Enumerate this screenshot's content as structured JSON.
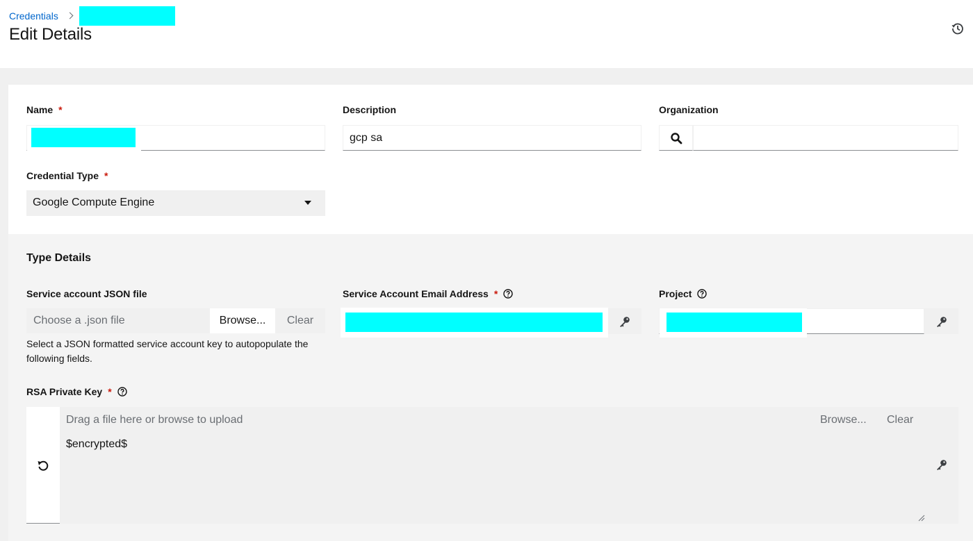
{
  "breadcrumb": {
    "root": "Credentials"
  },
  "page": {
    "title": "Edit Details"
  },
  "form": {
    "name": {
      "label": "Name",
      "required_mark": "*"
    },
    "description": {
      "label": "Description",
      "value": "gcp sa"
    },
    "organization": {
      "label": "Organization",
      "value": ""
    },
    "credential_type": {
      "label": "Credential Type",
      "required_mark": "*",
      "value": "Google Compute Engine"
    }
  },
  "type_details": {
    "title": "Type Details",
    "json_file": {
      "label": "Service account JSON file",
      "placeholder": "Choose a .json file",
      "browse_label": "Browse...",
      "clear_label": "Clear",
      "helper": "Select a JSON formatted service account key to autopopulate the following fields."
    },
    "email": {
      "label": "Service Account Email Address",
      "required_mark": "*"
    },
    "project": {
      "label": "Project"
    },
    "rsa_key": {
      "label": "RSA Private Key",
      "required_mark": "*",
      "drag_text": "Drag a file here or browse to upload",
      "browse_label": "Browse...",
      "clear_label": "Clear",
      "value": "$encrypted$"
    }
  },
  "colors": {
    "link": "#0066cc",
    "required": "#c9190b",
    "redaction": "#00ffff"
  }
}
